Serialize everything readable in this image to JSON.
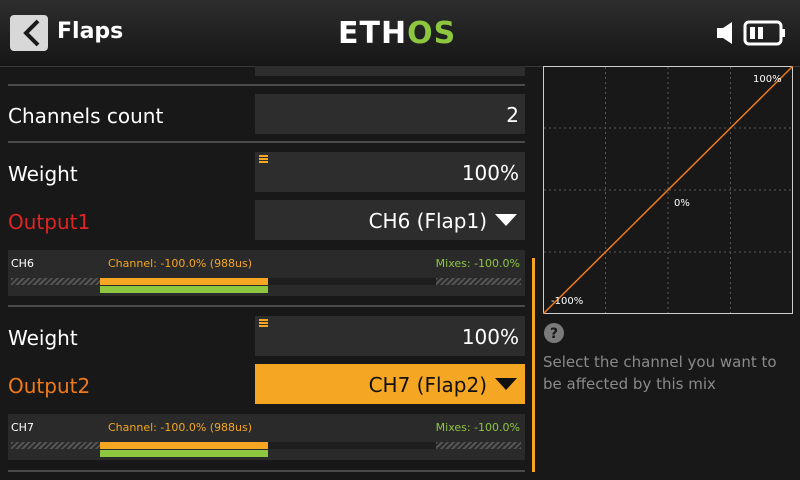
{
  "header": {
    "back_icon": "chevron-left-icon",
    "title": "Flaps",
    "logo": {
      "part1": "ETH",
      "part2": "OS"
    },
    "icons": [
      "speaker-icon",
      "battery-icon"
    ]
  },
  "form": {
    "channels_count": {
      "label": "Channels count",
      "value": "2"
    },
    "weight1": {
      "label": "Weight",
      "value": "100%"
    },
    "output1": {
      "label": "Output1",
      "value": "CH6 (Flap1)"
    },
    "monitor1": {
      "channel": "CH6",
      "channel_value": "Channel: -100.0% (988us)",
      "mixes_value": "Mixes: -100.0%",
      "channel_level": -1.0,
      "mixes_level": -1.0
    },
    "weight2": {
      "label": "Weight",
      "value": "100%"
    },
    "output2": {
      "label": "Output2",
      "value": "CH7 (Flap2)"
    },
    "monitor2": {
      "channel": "CH7",
      "channel_value": "Channel: -100.0% (988us)",
      "mixes_value": "Mixes: -100.0%",
      "channel_level": -1.0,
      "mixes_level": -1.0
    }
  },
  "curve": {
    "label_top": "100%",
    "label_mid": "0%",
    "label_bottom": "-100%",
    "points": [
      [
        -100,
        -100
      ],
      [
        100,
        100
      ]
    ],
    "line_color": "#f07a1a"
  },
  "help": {
    "icon": "question-icon",
    "text": "Select the channel you want to be affected by this mix"
  },
  "colors": {
    "accent": "#f5a623",
    "green": "#8dc63f",
    "red": "#e02424",
    "orange": "#f07a1a"
  }
}
